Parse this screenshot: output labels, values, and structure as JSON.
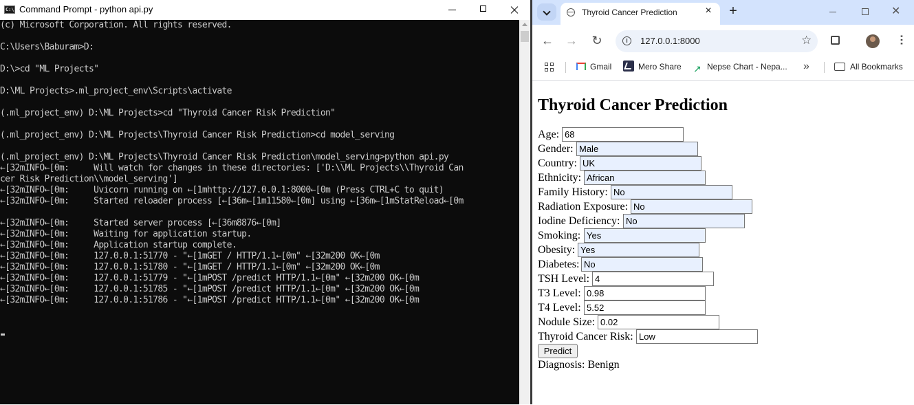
{
  "cmd": {
    "title": "Command Prompt - python  api.py",
    "lines": [
      "(c) Microsoft Corporation. All rights reserved.",
      "",
      "C:\\Users\\Baburam>D:",
      "",
      "D:\\>cd \"ML Projects\"",
      "",
      "D:\\ML Projects>.ml_project_env\\Scripts\\activate",
      "",
      "(.ml_project_env) D:\\ML Projects>cd \"Thyroid Cancer Risk Prediction\"",
      "",
      "(.ml_project_env) D:\\ML Projects\\Thyroid Cancer Risk Prediction>cd model_serving",
      "",
      "(.ml_project_env) D:\\ML Projects\\Thyroid Cancer Risk Prediction\\model_serving>python api.py",
      "←[32mINFO←[0m:     Will watch for changes in these directories: ['D:\\\\ML Projects\\\\Thyroid Can",
      "cer Risk Prediction\\\\model_serving']",
      "←[32mINFO←[0m:     Uvicorn running on ←[1mhttp://127.0.0.1:8000←[0m (Press CTRL+C to quit)",
      "←[32mINFO←[0m:     Started reloader process [←[36m←[1m11580←[0m] using ←[36m←[1mStatReload←[0m",
      "",
      "←[32mINFO←[0m:     Started server process [←[36m8876←[0m]",
      "←[32mINFO←[0m:     Waiting for application startup.",
      "←[32mINFO←[0m:     Application startup complete.",
      "←[32mINFO←[0m:     127.0.0.1:51770 - \"←[1mGET / HTTP/1.1←[0m\" ←[32m200 OK←[0m",
      "←[32mINFO←[0m:     127.0.0.1:51780 - \"←[1mGET / HTTP/1.1←[0m\" ←[32m200 OK←[0m",
      "←[32mINFO←[0m:     127.0.0.1:51779 - \"←[1mPOST /predict HTTP/1.1←[0m\" ←[32m200 OK←[0m",
      "←[32mINFO←[0m:     127.0.0.1:51785 - \"←[1mPOST /predict HTTP/1.1←[0m\" ←[32m200 OK←[0m",
      "←[32mINFO←[0m:     127.0.0.1:51786 - \"←[1mPOST /predict HTTP/1.1←[0m\" ←[32m200 OK←[0m"
    ]
  },
  "browser": {
    "tab_title": "Thyroid Cancer Prediction",
    "url": "127.0.0.1:8000",
    "bookmarks": [
      "Gmail",
      "Mero Share",
      "Nepse Chart - Nepa...",
      "All Bookmarks"
    ]
  },
  "page": {
    "title": "Thyroid Cancer Prediction",
    "fields": [
      {
        "label": "Age:",
        "value": "68"
      },
      {
        "label": "Gender:",
        "value": "Male"
      },
      {
        "label": "Country:",
        "value": "UK"
      },
      {
        "label": "Ethnicity:",
        "value": "African"
      },
      {
        "label": "Family History:",
        "value": "No"
      },
      {
        "label": "Radiation Exposure:",
        "value": "No"
      },
      {
        "label": "Iodine Deficiency:",
        "value": "No"
      },
      {
        "label": "Smoking:",
        "value": "Yes"
      },
      {
        "label": "Obesity:",
        "value": "Yes"
      },
      {
        "label": "Diabetes:",
        "value": "No"
      },
      {
        "label": "TSH Level:",
        "value": "4"
      },
      {
        "label": "T3 Level:",
        "value": "0.98"
      },
      {
        "label": "T4 Level:",
        "value": "5.52"
      },
      {
        "label": "Nodule Size:",
        "value": "0.02"
      },
      {
        "label": "Thyroid Cancer Risk:",
        "value": "Low"
      }
    ],
    "predict_label": "Predict",
    "diagnosis": "Diagnosis: Benign"
  }
}
